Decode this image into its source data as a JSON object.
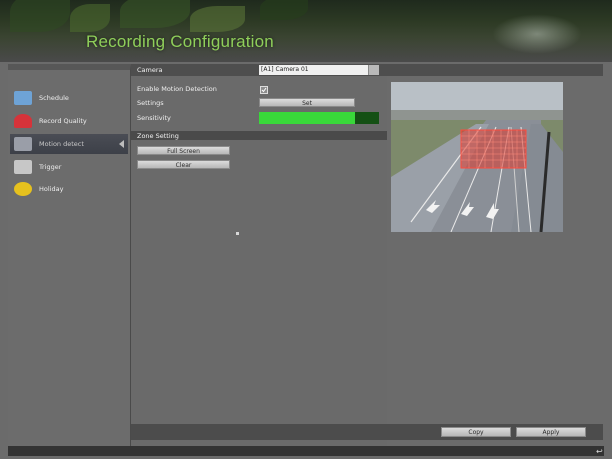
{
  "header": {
    "title": "Recording Configuration"
  },
  "sidebar": {
    "items": [
      {
        "label": "Schedule",
        "icon": "schedule-icon",
        "color": "#6ea3d6"
      },
      {
        "label": "Record Quality",
        "icon": "record-quality-icon",
        "color": "#d6333a"
      },
      {
        "label": "Motion detect",
        "icon": "motion-detect-icon",
        "color": "#9a9ea8"
      },
      {
        "label": "Trigger",
        "icon": "trigger-icon",
        "color": "#c7c7c7"
      },
      {
        "label": "Holiday",
        "icon": "holiday-icon",
        "color": "#e6c11e"
      }
    ],
    "active_index": 2
  },
  "settings": {
    "camera_label": "Camera",
    "camera_value": "[A1] Camera 01",
    "enable_motion_label": "Enable Motion Detection",
    "enable_motion_checked": true,
    "settings_label": "Settings",
    "set_button": "Set",
    "sensitivity_label": "Sensitivity",
    "sensitivity_level": 0.8
  },
  "zone": {
    "title": "Zone Setting",
    "full_screen_button": "Full Screen",
    "clear_button": "Clear"
  },
  "footer": {
    "copy_button": "Copy",
    "apply_button": "Apply"
  },
  "colors": {
    "accent_green": "#39d83a",
    "title_green": "#8fcf5a",
    "motion_zone": "#e03a2e"
  }
}
